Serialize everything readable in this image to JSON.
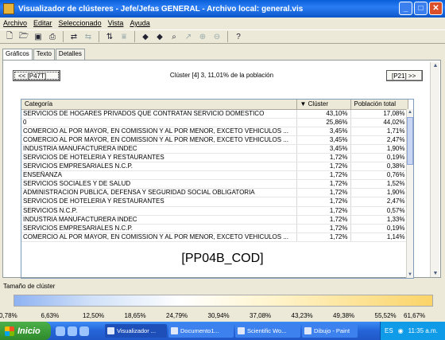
{
  "window": {
    "title": "Visualizador de clústeres - Jefe/Jefas GENERAL - Archivo local: general.vis",
    "controls": {
      "minimize": "_",
      "maximize": "□",
      "close": "✕"
    }
  },
  "menu": [
    "Archivo",
    "Editar",
    "Seleccionado",
    "Vista",
    "Ayuda"
  ],
  "toolbar_icons": [
    "new-icon",
    "open-icon",
    "save-icon",
    "print-icon",
    "refresh-icon",
    "back-icon",
    "sort-icon",
    "filter-icon",
    "prev-icon",
    "next-icon",
    "find-icon",
    "pointer-icon",
    "zoom-in-icon",
    "zoom-out-icon",
    "help-icon"
  ],
  "tabs": [
    "Gráficos",
    "Texto",
    "Detalles"
  ],
  "nav": {
    "prev_label": "<< [P47T]",
    "next_label": "[P21] >>"
  },
  "cluster_title": "Clúster [4] 3, 11,01% de la población",
  "table": {
    "columns": [
      "Categoría",
      "▼ Clúster",
      "Población total"
    ],
    "rows": [
      [
        "SERVICIOS DE HOGARES PRIVADOS QUE CONTRATAN SERVICIO DOMESTICO",
        "43,10%",
        "17,08%"
      ],
      [
        "0",
        "25,86%",
        "44,02%"
      ],
      [
        "COMERCIO AL POR MAYOR, EN COMISSION Y AL POR MENOR, EXCETO VEHICULOS ...",
        "3,45%",
        "1,71%"
      ],
      [
        "COMERCIO AL POR MAYOR, EN COMISSION Y AL POR MENOR, EXCETO VEHICULOS ...",
        "3,45%",
        "2,47%"
      ],
      [
        "INDUSTRIA MANUFACTURERA INDEC",
        "3,45%",
        "1,90%"
      ],
      [
        "SERVICIOS DE HOTELERIA Y RESTAURANTES",
        "1,72%",
        "0,19%"
      ],
      [
        "SERVICIOS EMPRESARIALES N.C.P.",
        "1,72%",
        "0,38%"
      ],
      [
        "ENSEÑANZA",
        "1,72%",
        "0,76%"
      ],
      [
        "SERVICIOS SOCIALES Y DE SALUD",
        "1,72%",
        "1,52%"
      ],
      [
        "ADMINISTRACION PUBLICA, DEFENSA Y SEGURIDAD SOCIAL OBLIGATORIA",
        "1,72%",
        "1,90%"
      ],
      [
        "SERVICIOS DE HOTELERIA Y RESTAURANTES",
        "1,72%",
        "2,47%"
      ],
      [
        "SERVICIOS N.C.P.",
        "1,72%",
        "0,57%"
      ],
      [
        "INDUSTRIA MANUFACTURERA INDEC",
        "1,72%",
        "1,33%"
      ],
      [
        "SERVICIOS EMPRESARIALES N.C.P.",
        "1,72%",
        "0,19%"
      ],
      [
        "COMERCIO AL POR MAYOR, EN COMISSION Y AL POR MENOR, EXCETO VEHICULOS ...",
        "1,72%",
        "1,14%"
      ]
    ]
  },
  "variable_name": "[PP04B_COD]",
  "cluster_size": {
    "label": "Tamaño de clúster",
    "ticks": [
      "0,78%",
      "6,63%",
      "12,50%",
      "18,65%",
      "24,79%",
      "30,94%",
      "37,08%",
      "43,23%",
      "49,38%",
      "55,52%",
      "61,67%"
    ]
  },
  "taskbar": {
    "start": "Inicio",
    "tasks": [
      "Visualizador ...",
      "Documento1...",
      "Scientific Wo...",
      "Dibujo - Paint"
    ],
    "lang": "ES",
    "clock": "11:35 a.m."
  },
  "colors": {
    "title_blue": "#0a5fd8",
    "taskbar_blue": "#2464d8",
    "start_green": "#3a9c36",
    "gradient_low": "#8eb2f2",
    "gradient_high": "#fbd468"
  }
}
